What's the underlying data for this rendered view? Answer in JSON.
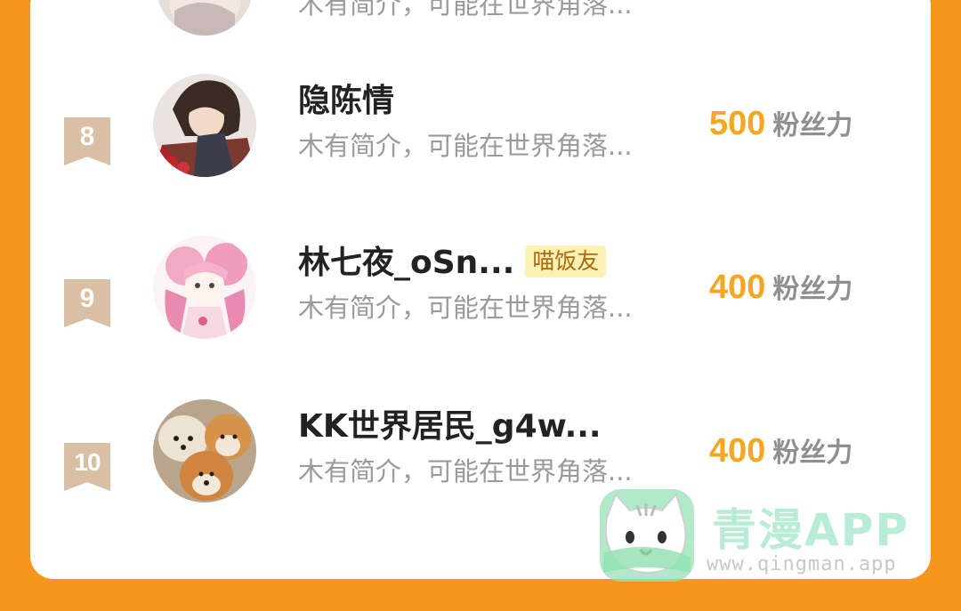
{
  "leaderboard": {
    "score_unit": "粉丝力",
    "rows": [
      {
        "rank": "",
        "name": "",
        "badge": "",
        "bio": "木有简介，可能在世界角落...",
        "score": ""
      },
      {
        "rank": "8",
        "name": "隐陈情",
        "badge": "",
        "bio": "木有简介，可能在世界角落...",
        "score": "500"
      },
      {
        "rank": "9",
        "name": "林七夜_oSn...",
        "badge": "喵饭友",
        "bio": "木有简介，可能在世界角落...",
        "score": "400"
      },
      {
        "rank": "10",
        "name": "KK世界居民_g4w...",
        "badge": "",
        "bio": "木有简介，可能在世界角落...",
        "score": "400"
      }
    ]
  },
  "watermark": {
    "title": "青漫APP",
    "url": "www.qingman.app"
  },
  "colors": {
    "background": "#F7961C",
    "rank_ribbon": "#D9BFA4",
    "score": "#F5A623",
    "badge_bg": "#FFF0B3"
  }
}
